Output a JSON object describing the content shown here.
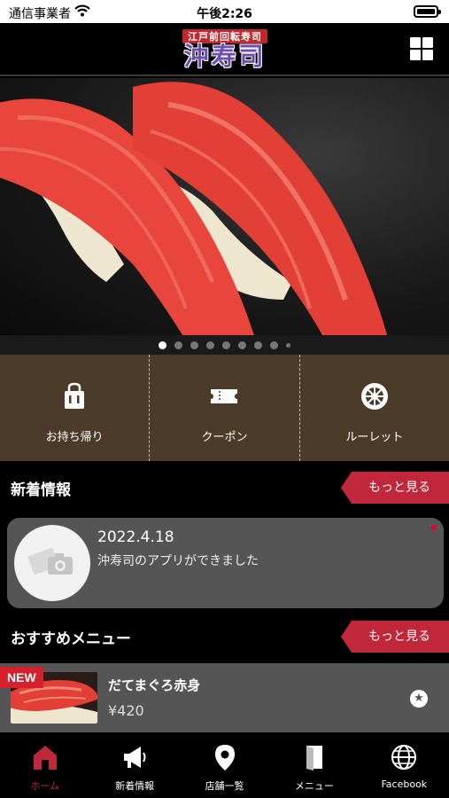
{
  "status_bar": {
    "carrier": "通信事業者",
    "time": "午後2:26"
  },
  "header": {
    "logo_sub": "江戸前回転寿司",
    "logo_main": "沖寿司",
    "grid_icon": "grid-menu-icon"
  },
  "carousel": {
    "slide_count": 9,
    "active_index": 0
  },
  "quick_menu": [
    {
      "label": "お持ち帰り",
      "icon": "takeout-bag-icon"
    },
    {
      "label": "クーポン",
      "icon": "ticket-icon"
    },
    {
      "label": "ルーレット",
      "icon": "roulette-icon"
    }
  ],
  "news": {
    "title": "新着情報",
    "more_label": "もっと見る",
    "items": [
      {
        "date": "2022.4.18",
        "text": "沖寿司のアプリができました"
      }
    ]
  },
  "recommend": {
    "title": "おすすめメニュー",
    "more_label": "もっと見る",
    "items": [
      {
        "badge": "NEW",
        "name": "だてまぐろ赤身",
        "price": "¥420"
      }
    ]
  },
  "tab_bar": [
    {
      "label": "ホーム",
      "icon": "home-icon",
      "active": true
    },
    {
      "label": "新着情報",
      "icon": "megaphone-icon",
      "active": false
    },
    {
      "label": "店舗一覧",
      "icon": "map-pin-icon",
      "active": false
    },
    {
      "label": "メニュー",
      "icon": "menu-book-icon",
      "active": false
    },
    {
      "label": "Facebook",
      "icon": "globe-icon",
      "active": false
    }
  ],
  "colors": {
    "accent": "#c1273a",
    "quick_menu_bg": "#4d3b2a",
    "card_bg": "#555555"
  }
}
